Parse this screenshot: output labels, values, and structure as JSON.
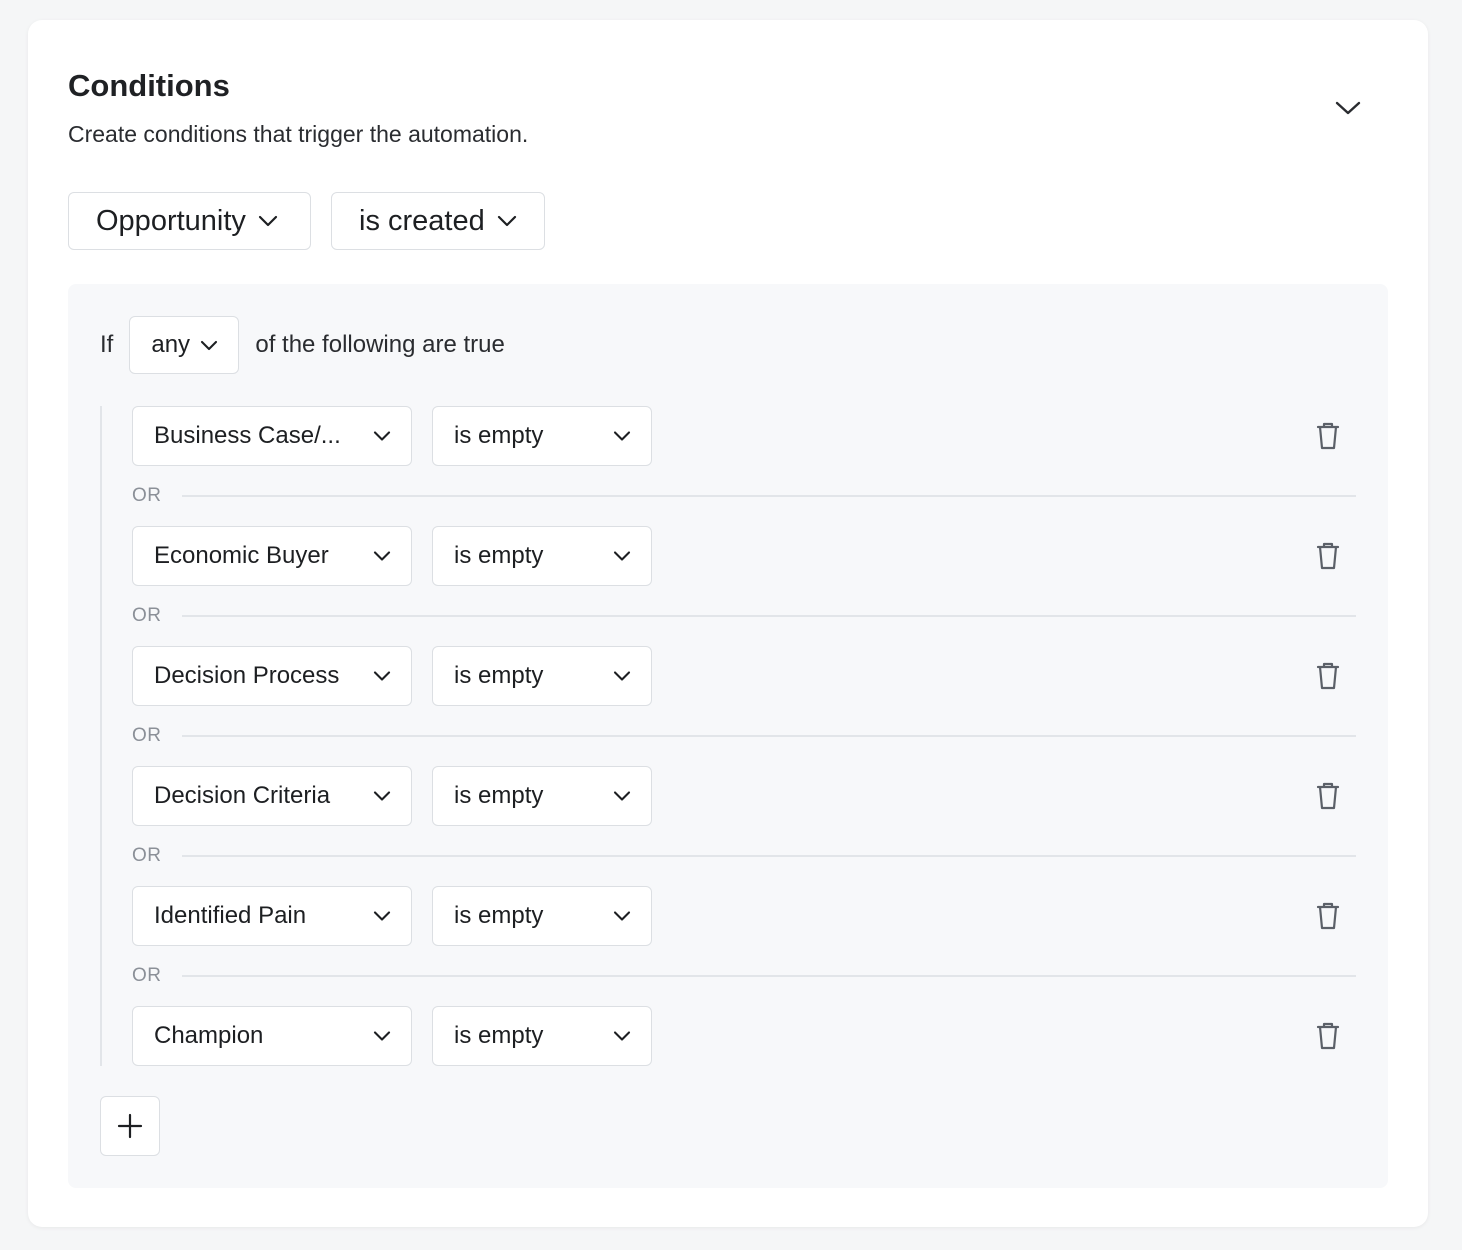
{
  "section": {
    "title": "Conditions",
    "subtitle": "Create conditions that trigger the automation."
  },
  "trigger": {
    "object": "Opportunity",
    "event": "is created"
  },
  "group": {
    "prefix": "If",
    "match": "any",
    "suffix": "of the following are true"
  },
  "conditions": [
    {
      "field": "Business Case/...",
      "operator": "is empty"
    },
    {
      "field": "Economic Buyer",
      "operator": "is empty"
    },
    {
      "field": "Decision Process",
      "operator": "is empty"
    },
    {
      "field": "Decision Criteria",
      "operator": "is empty"
    },
    {
      "field": "Identified Pain",
      "operator": "is empty"
    },
    {
      "field": "Champion",
      "operator": "is empty"
    }
  ],
  "separator_label": "OR",
  "icons": {
    "collapse": "chevron-down-icon",
    "delete": "trash-icon",
    "add": "plus-icon"
  },
  "colors": {
    "border": "#dcdfe3",
    "panel_bg": "#f7f8fa",
    "muted_text": "#8b9098"
  }
}
